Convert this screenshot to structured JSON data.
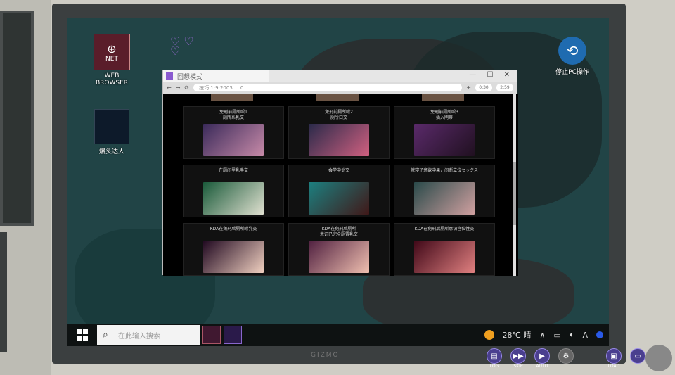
{
  "desktop": {
    "net_icon_text": "NET",
    "net_icon_label": "WEB BROWSER",
    "girl_icon_label": "爆头达人",
    "right_icon_label": "停止PC操作"
  },
  "browser": {
    "tab_title": "回想模式",
    "address": "技巧 1:9:2003 ... 0 ...",
    "mini1": "0:30",
    "mini2": "2:59",
    "items": [
      {
        "title": "免刑前厕所殴1\n厕所系乳交",
        "c1": "#3a2a5a",
        "c2": "#c78aa8"
      },
      {
        "title": "免刑前厕所殴2\n厕所口交",
        "c1": "#2a2a4a",
        "c2": "#d06080"
      },
      {
        "title": "免刑前厕所殴3\n插入阴蒂",
        "c1": "#5a2a6a",
        "c2": "#201020"
      },
      {
        "title": "在厕间里乳手交",
        "c1": "#1a5a3a",
        "c2": "#e0e0d0"
      },
      {
        "title": "会堂中处交",
        "c1": "#1c8080",
        "c2": "#401818"
      },
      {
        "title": "就寝了意欲中果，间断立位セックス",
        "c1": "#2a4a4a",
        "c2": "#d0a0a0"
      },
      {
        "title": "KDA在免刑后厕所殴乳交",
        "c1": "#200820",
        "c2": "#f0d0c0"
      },
      {
        "title": "KDA在免刑后厕所\n意识已完全厕置乳交",
        "c1": "#502040",
        "c2": "#f0c0b0"
      },
      {
        "title": "KDA在免刑后厕所意识宫位性交",
        "c1": "#400818",
        "c2": "#e08080"
      }
    ]
  },
  "taskbar": {
    "search_placeholder": "在此输入搜索",
    "weather": "28℃ 晴",
    "tray_up": "∧",
    "tray_font": "A"
  },
  "gamebar": {
    "log": "LOG",
    "skip": "SKIP",
    "auto": "AUTO",
    "load": "LOAD"
  },
  "monitor_brand": "GIZMO"
}
